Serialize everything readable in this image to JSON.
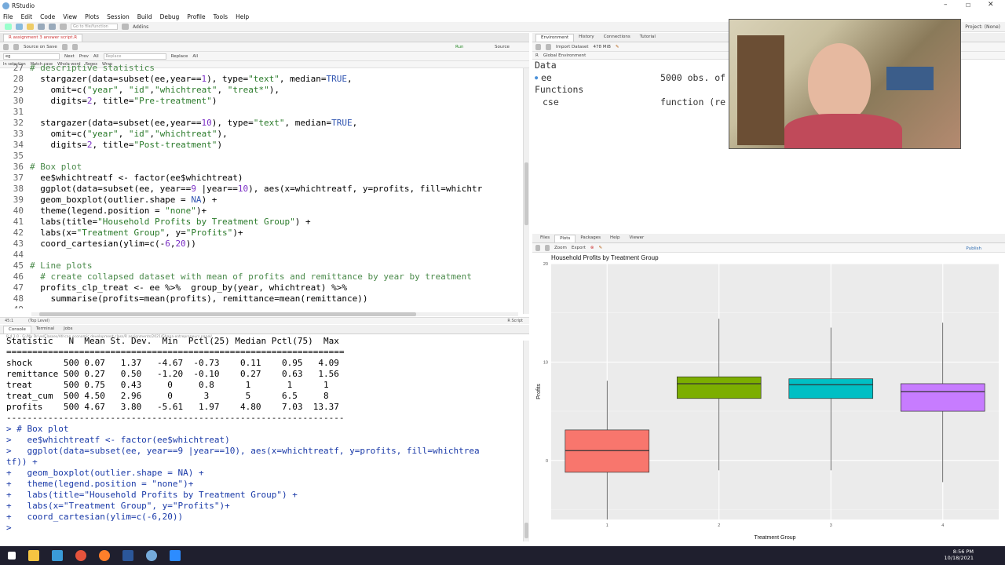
{
  "window": {
    "title": "RStudio"
  },
  "menu": [
    "File",
    "Edit",
    "Code",
    "View",
    "Plots",
    "Session",
    "Build",
    "Debug",
    "Profile",
    "Tools",
    "Help"
  ],
  "toolbar": {
    "goto_placeholder": "Go to file/function",
    "addins": "Addins",
    "project": "Project: (None)"
  },
  "source": {
    "tab_label": "R assignment 3 answer script.R",
    "source_on_save": "Source on Save",
    "run": "Run",
    "source_btn": "Source",
    "find_value": "eg",
    "find_buttons": [
      "Next",
      "Prev",
      "All"
    ],
    "replace_placeholder": "Replace",
    "replace_buttons": [
      "Replace",
      "All"
    ],
    "options": [
      "In selection",
      "Match case",
      "Whole word",
      "Regex",
      "Wrap"
    ],
    "status_left": "45:1",
    "status_mid": "(Top Level)",
    "status_right": "R Script",
    "lines": [
      {
        "n": "27",
        "t": "# descriptive statistics"
      },
      {
        "n": "28",
        "t": "  stargazer(data=subset(ee,year==1), type=\"text\", median=TRUE,"
      },
      {
        "n": "29",
        "t": "    omit=c(\"year\", \"id\",\"whichtreat\", \"treat*\"),"
      },
      {
        "n": "30",
        "t": "    digits=2, title=\"Pre-treatment\")"
      },
      {
        "n": "31",
        "t": ""
      },
      {
        "n": "32",
        "t": "  stargazer(data=subset(ee,year==10), type=\"text\", median=TRUE,"
      },
      {
        "n": "33",
        "t": "    omit=c(\"year\", \"id\",\"whichtreat\"),"
      },
      {
        "n": "34",
        "t": "    digits=2, title=\"Post-treatment\")"
      },
      {
        "n": "35",
        "t": ""
      },
      {
        "n": "36",
        "t": "# Box plot"
      },
      {
        "n": "37",
        "t": "  ee$whichtreatf <- factor(ee$whichtreat)"
      },
      {
        "n": "38",
        "t": "  ggplot(data=subset(ee, year==9 |year==10), aes(x=whichtreatf, y=profits, fill=whichtr"
      },
      {
        "n": "39",
        "t": "  geom_boxplot(outlier.shape = NA) +"
      },
      {
        "n": "40",
        "t": "  theme(legend.position = \"none\")+"
      },
      {
        "n": "41",
        "t": "  labs(title=\"Household Profits by Treatment Group\") +"
      },
      {
        "n": "42",
        "t": "  labs(x=\"Treatment Group\", y=\"Profits\")+"
      },
      {
        "n": "43",
        "t": "  coord_cartesian(ylim=c(-6,20))"
      },
      {
        "n": "44",
        "t": ""
      },
      {
        "n": "45",
        "t": "# Line plots"
      },
      {
        "n": "46",
        "t": "  # create collapsed dataset with mean of profits and remittance by year by treatment"
      },
      {
        "n": "47",
        "t": "  profits_clp_treat <- ee %>%  group_by(year, whichtreat) %>%"
      },
      {
        "n": "48",
        "t": "    summarise(profits=mean(profits), remittance=mean(remittance))"
      },
      {
        "n": "49",
        "t": ""
      }
    ]
  },
  "console": {
    "tabs": [
      "Console",
      "Terminal",
      "Jobs"
    ],
    "path": "R 4.1.0 · G:/My Drive/Classes/African economic development class/R assignments/2021/Ghana entrepreneurs panel/",
    "lines": [
      "Statistic   N  Mean St. Dev.  Min  Pctl(25) Median Pctl(75)  Max",
      "=================================================================",
      "shock      500 0.07   1.37   -4.67  -0.73    0.11    0.95   4.09",
      "remittance 500 0.27   0.50   -1.20  -0.10    0.27    0.63   1.56",
      "treat      500 0.75   0.43     0     0.8      1       1      1",
      "treat_cum  500 4.50   2.96     0      3       5      6.5     8",
      "profits    500 4.67   3.80   -5.61   1.97    4.80    7.03  13.37",
      "-----------------------------------------------------------------",
      "",
      "> # Box plot",
      ">   ee$whichtreatf <- factor(ee$whichtreat)",
      ">   ggplot(data=subset(ee, year==9 |year==10), aes(x=whichtreatf, y=profits, fill=whichtrea",
      "tf)) +",
      "+   geom_boxplot(outlier.shape = NA) +",
      "+   theme(legend.position = \"none\")+",
      "+   labs(title=\"Household Profits by Treatment Group\") +",
      "+   labs(x=\"Treatment Group\", y=\"Profits\")+",
      "+   coord_cartesian(ylim=c(-6,20))",
      "> "
    ]
  },
  "environment": {
    "tabs": [
      "Environment",
      "History",
      "Connections",
      "Tutorial"
    ],
    "import": "Import Dataset",
    "memory": "478 MiB",
    "scope": "Global Environment",
    "sections": [
      {
        "header": "Data",
        "rows": [
          {
            "name": "ee",
            "value": "5000 obs. of"
          }
        ]
      },
      {
        "header": "Functions",
        "rows": [
          {
            "name": "cse",
            "value": "function (re"
          }
        ]
      }
    ]
  },
  "plots": {
    "tabs": [
      "Files",
      "Plots",
      "Packages",
      "Help",
      "Viewer"
    ],
    "zoom": "Zoom",
    "export": "Export",
    "publish": "Publish"
  },
  "chart_data": {
    "type": "box",
    "title": "Household Profits by Treatment Group",
    "xlabel": "Treatment Group",
    "ylabel": "Profits",
    "ylim": [
      -6,
      20
    ],
    "yticks": [
      0,
      10,
      20
    ],
    "categories": [
      "1",
      "2",
      "3",
      "4"
    ],
    "boxes": [
      {
        "label": "1",
        "whisker_low": -6,
        "q1": -1.2,
        "median": 1.0,
        "q3": 3.1,
        "whisker_high": 8.1,
        "color": "#f8766d"
      },
      {
        "label": "2",
        "whisker_low": -1,
        "q1": 6.3,
        "median": 7.8,
        "q3": 8.5,
        "whisker_high": 14.4,
        "color": "#7cae00"
      },
      {
        "label": "3",
        "whisker_low": -1,
        "q1": 6.3,
        "median": 7.7,
        "q3": 8.3,
        "whisker_high": 13.5,
        "color": "#00bfc4"
      },
      {
        "label": "4",
        "whisker_low": -2.2,
        "q1": 5.0,
        "median": 7.0,
        "q3": 7.8,
        "whisker_high": 14.0,
        "color": "#c77cff"
      }
    ]
  },
  "taskbar": {
    "time": "8:56 PM",
    "date": "10/18/2021"
  }
}
